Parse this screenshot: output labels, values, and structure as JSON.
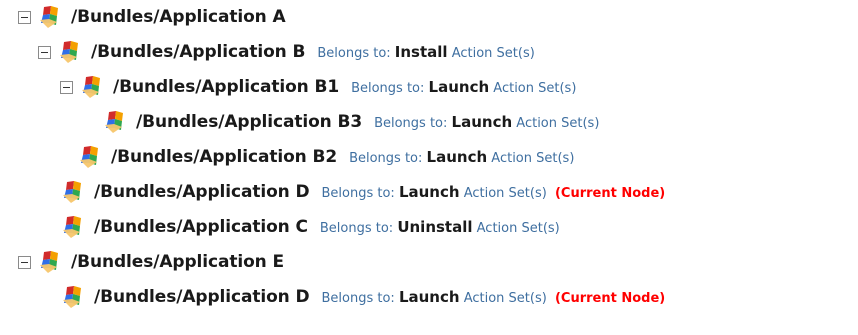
{
  "tree": {
    "belongs_label": "Belongs to:",
    "action_set_label": "Action Set(s)",
    "current_label": "(Current Node)",
    "nodes": [
      {
        "path": "/Bundles/Application A",
        "expanded": true
      },
      {
        "path": "/Bundles/Application B",
        "action": "Install",
        "expanded": true
      },
      {
        "path": "/Bundles/Application B1",
        "action": "Launch",
        "expanded": true
      },
      {
        "path": "/Bundles/Application B3",
        "action": "Launch"
      },
      {
        "path": "/Bundles/Application B2",
        "action": "Launch"
      },
      {
        "path": "/Bundles/Application D",
        "action": "Launch",
        "current": true
      },
      {
        "path": "/Bundles/Application C",
        "action": "Uninstall"
      },
      {
        "path": "/Bundles/Application E",
        "expanded": true
      },
      {
        "path": "/Bundles/Application D",
        "action": "Launch",
        "current": true
      }
    ]
  },
  "icons": {
    "node": "bundle-node-icon",
    "toggle": "collapse-toggle-icon"
  },
  "colors": {
    "meta_text": "#3f6fa0",
    "current_text": "#ff0000",
    "icon_red": "#d12b2b",
    "icon_orange": "#f4a000",
    "icon_green": "#2fa84f",
    "icon_blue": "#2f6ee8"
  }
}
